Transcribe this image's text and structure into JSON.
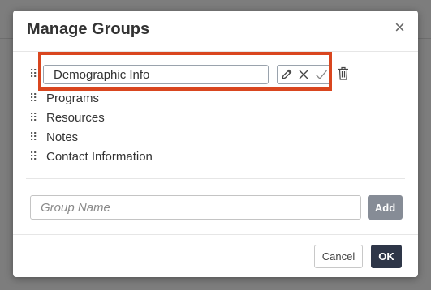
{
  "modal": {
    "title": "Manage Groups",
    "close_glyph": "×"
  },
  "groups": [
    {
      "label": "Demographic Info",
      "editing": true
    },
    {
      "label": "Programs"
    },
    {
      "label": "Resources"
    },
    {
      "label": "Notes"
    },
    {
      "label": "Contact Information"
    }
  ],
  "drag_glyph": "⠿",
  "edit_actions": {
    "icons": [
      "pencil-icon",
      "close-icon",
      "check-icon"
    ],
    "delete_icon": "trash-icon"
  },
  "new_group": {
    "placeholder": "Group Name",
    "add_label": "Add"
  },
  "footer": {
    "cancel_label": "Cancel",
    "ok_label": "OK"
  },
  "colors": {
    "highlight": "#d9461f",
    "primary_button": "#2e3648",
    "add_button": "#868c96"
  }
}
